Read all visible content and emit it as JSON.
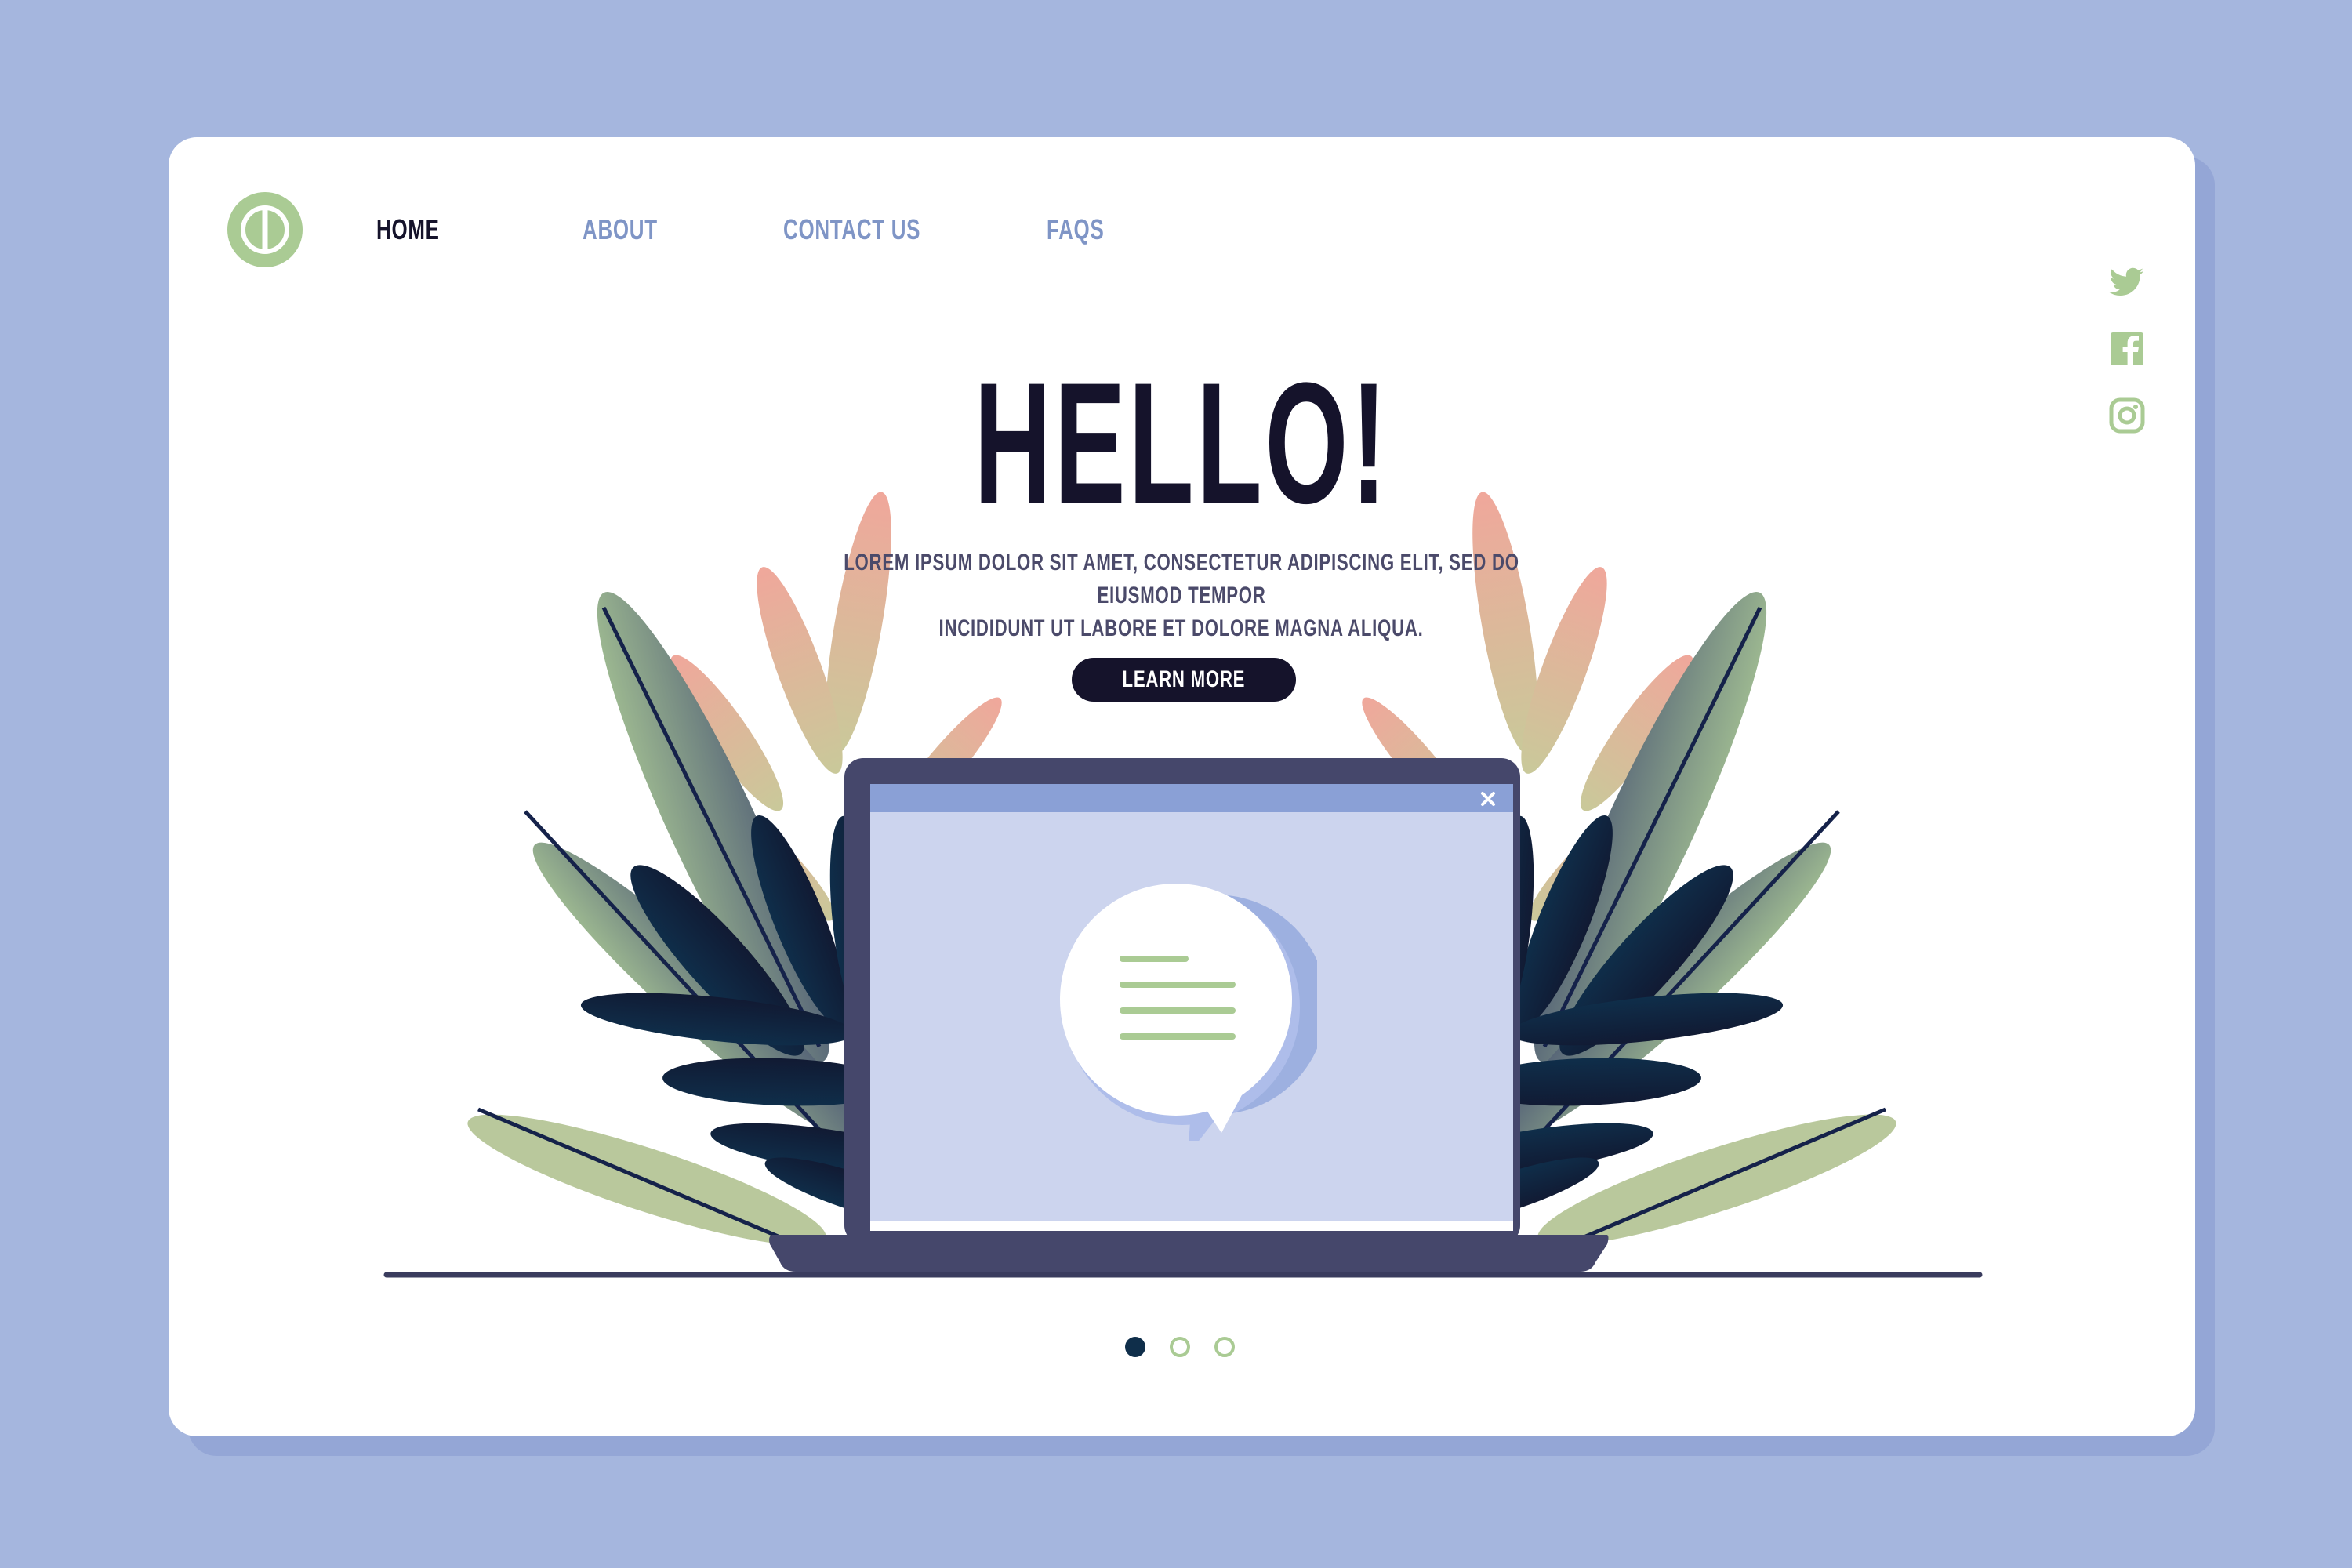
{
  "nav": {
    "items": [
      {
        "label": "HOME",
        "active": true
      },
      {
        "label": "ABOUT",
        "active": false
      },
      {
        "label": "CONTACT US",
        "active": false
      },
      {
        "label": "FAQS",
        "active": false
      }
    ]
  },
  "social": {
    "icons": [
      "twitter-icon",
      "facebook-icon",
      "instagram-icon"
    ]
  },
  "hero": {
    "title": "HELLO!",
    "subtitle_line1": "LOREM IPSUM DOLOR SIT AMET, CONSECTETUR ADIPISCING ELIT, SED DO EIUSMOD TEMPOR",
    "subtitle_line2": "INCIDIDUNT UT LABORE ET DOLORE MAGNA ALIQUA.",
    "button_label": "LEARN MORE"
  },
  "carousel": {
    "total": 3,
    "active": 1
  },
  "colors": {
    "background": "#a5b6de",
    "card": "#ffffff",
    "accent_green": "#aacb94",
    "dark": "#15132b",
    "nav_inactive": "#7f95c6",
    "laptop": "#45476b",
    "screen": "#ccd4ee",
    "window_bar": "#8aa0d6"
  }
}
